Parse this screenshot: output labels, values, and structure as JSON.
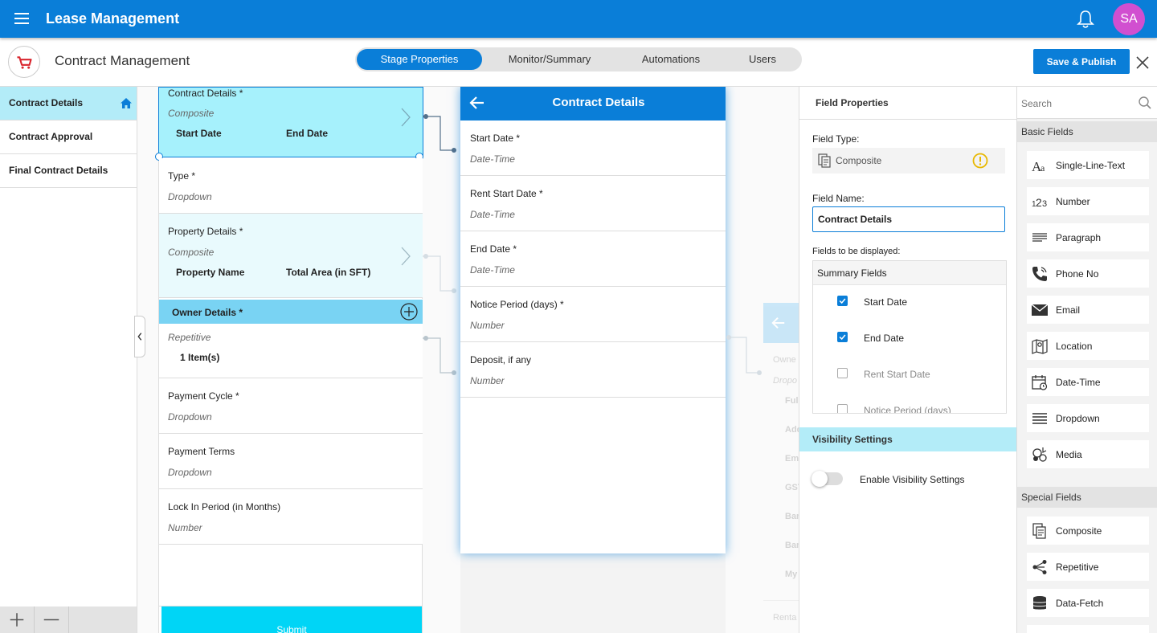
{
  "app": {
    "title": "Lease Management",
    "user_initials": "SA"
  },
  "header": {
    "page_title": "Contract Management",
    "tabs": [
      {
        "label": "Stage Properties",
        "active": true
      },
      {
        "label": "Monitor/Summary",
        "active": false
      },
      {
        "label": "Automations",
        "active": false
      },
      {
        "label": "Users",
        "active": false
      }
    ],
    "publish_label": "Save & Publish"
  },
  "stages": [
    {
      "label": "Contract Details",
      "active": true
    },
    {
      "label": "Contract Approval",
      "active": false
    },
    {
      "label": "Final Contract Details",
      "active": false
    }
  ],
  "form_fields": [
    {
      "label": "Contract Details *",
      "type": "Composite",
      "sub": [
        "Start Date",
        "End Date"
      ]
    },
    {
      "label": "Type *",
      "type": "Dropdown"
    },
    {
      "label": "Property Details *",
      "type": "Composite",
      "sub": [
        "Property Name",
        "Total Area (in SFT)"
      ]
    },
    {
      "label": "Owner Details *",
      "type": "Repetitive",
      "items": "1 Item(s)"
    },
    {
      "label": "Payment Cycle *",
      "type": "Dropdown"
    },
    {
      "label": "Payment Terms",
      "type": "Dropdown"
    },
    {
      "label": "Lock In Period (in Months)",
      "type": "Number"
    }
  ],
  "submit_label": "Submit",
  "detail": {
    "title": "Contract Details",
    "fields": [
      {
        "label": "Start Date *",
        "type": "Date-Time"
      },
      {
        "label": "Rent Start Date *",
        "type": "Date-Time"
      },
      {
        "label": "End Date *",
        "type": "Date-Time"
      },
      {
        "label": "Notice Period (days) *",
        "type": "Number"
      },
      {
        "label": "Deposit, if any",
        "type": "Number"
      }
    ]
  },
  "ghost": {
    "texts": [
      "Owne",
      "Dropo",
      "Ful",
      "Add",
      "Em",
      "GST",
      "Ban",
      "Ban",
      "My",
      "Renta"
    ]
  },
  "field_properties": {
    "title": "Field Properties",
    "field_type_label": "Field Type:",
    "field_type_value": "Composite",
    "field_name_label": "Field Name:",
    "field_name_value": "Contract Details",
    "display_label": "Fields to be displayed:",
    "summary_header": "Summary Fields",
    "summary_fields": [
      {
        "label": "Start Date",
        "checked": true
      },
      {
        "label": "End Date",
        "checked": true
      },
      {
        "label": "Rent Start Date",
        "checked": false
      },
      {
        "label": "Notice Period (days)",
        "checked": false
      }
    ],
    "visibility_title": "Visibility Settings",
    "visibility_toggle_label": "Enable Visibility Settings",
    "visibility_enabled": false
  },
  "palette": {
    "search_placeholder": "Search",
    "basic_title": "Basic Fields",
    "basic": [
      {
        "label": "Single-Line-Text",
        "icon": "text-icon"
      },
      {
        "label": "Number",
        "icon": "number-icon"
      },
      {
        "label": "Paragraph",
        "icon": "paragraph-icon"
      },
      {
        "label": "Phone No",
        "icon": "phone-icon"
      },
      {
        "label": "Email",
        "icon": "email-icon"
      },
      {
        "label": "Location",
        "icon": "map-icon"
      },
      {
        "label": "Date-Time",
        "icon": "calendar-icon"
      },
      {
        "label": "Dropdown",
        "icon": "list-icon"
      },
      {
        "label": "Media",
        "icon": "media-icon"
      }
    ],
    "special_title": "Special Fields",
    "special": [
      {
        "label": "Composite",
        "icon": "composite-icon"
      },
      {
        "label": "Repetitive",
        "icon": "share-icon"
      },
      {
        "label": "Data-Fetch",
        "icon": "database-icon"
      }
    ]
  },
  "colors": {
    "primary": "#0a7ed8",
    "selected_bg": "#b3ecf8",
    "submit": "#00d5f6",
    "warning": "#e8b800",
    "avatar": "#d14fd0"
  }
}
